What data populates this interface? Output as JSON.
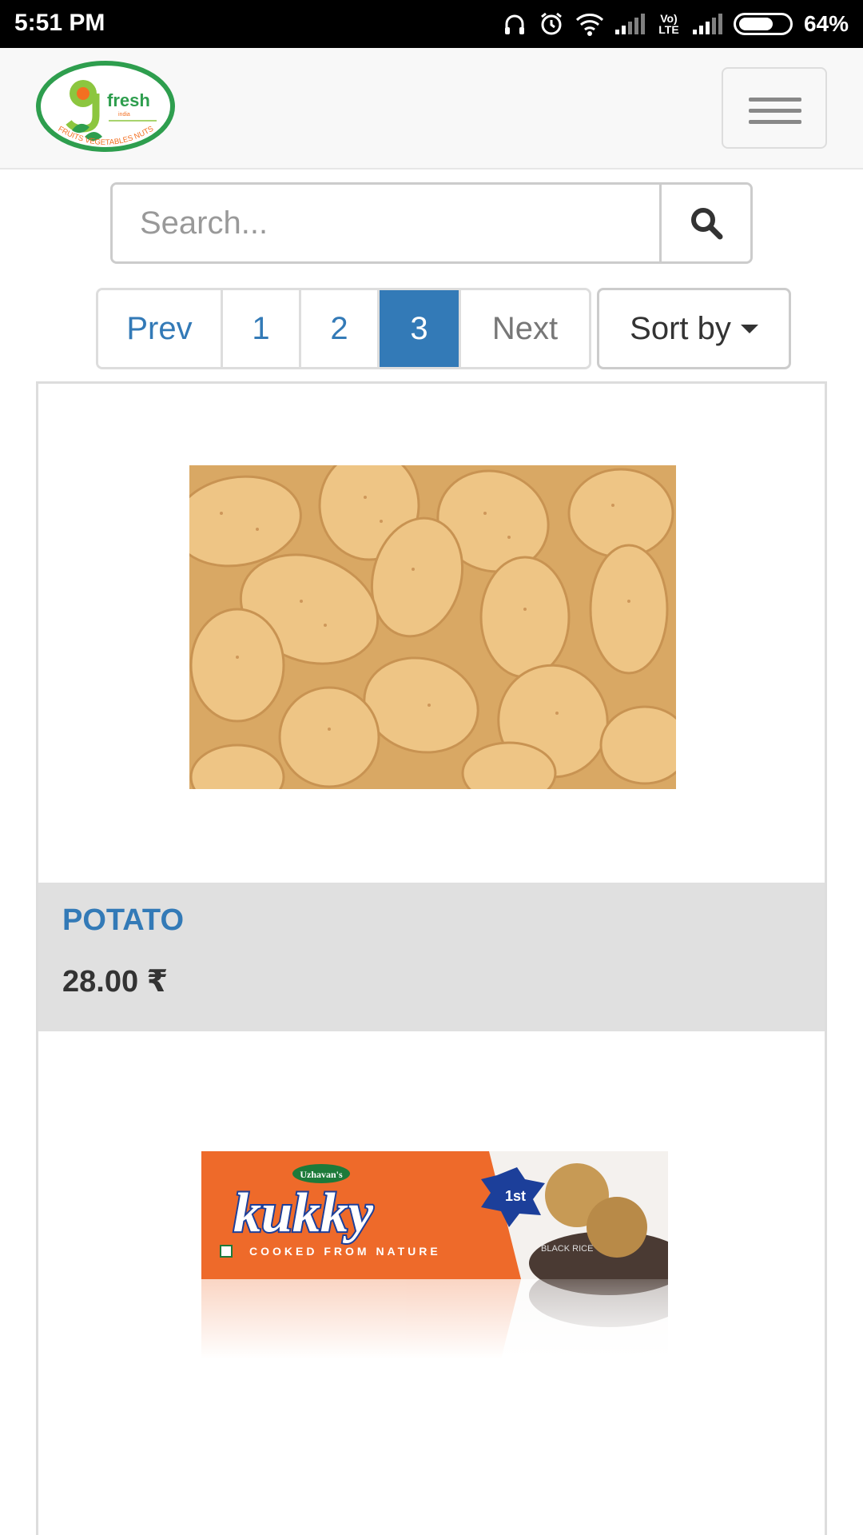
{
  "status_bar": {
    "time": "5:51 PM",
    "battery": "64%",
    "network": "Vo) LTE"
  },
  "navbar": {
    "logo": {
      "brand": "fresh",
      "sub": "india",
      "tagline": "FRUITS VEGETABLES NUTS"
    }
  },
  "search": {
    "placeholder": "Search..."
  },
  "pagination": {
    "prev": "Prev",
    "pages": [
      "1",
      "2",
      "3"
    ],
    "active_page": "3",
    "next": "Next"
  },
  "sort": {
    "label": "Sort by"
  },
  "products": [
    {
      "name": "POTATO",
      "price": "28.00 ₹",
      "image": "potatoes"
    },
    {
      "image": "kukky biscuit box",
      "package": {
        "brand_small": "Uzhavan's",
        "brand": "kukky",
        "badge": "1st",
        "tagline": "COOKED FROM NATURE",
        "variant": "BLACK RICE"
      }
    }
  ],
  "colors": {
    "link": "#337ab7",
    "active_page_bg": "#337ab7",
    "info_bg": "#e0e0e0",
    "navbar_bg": "#f8f8f8"
  }
}
